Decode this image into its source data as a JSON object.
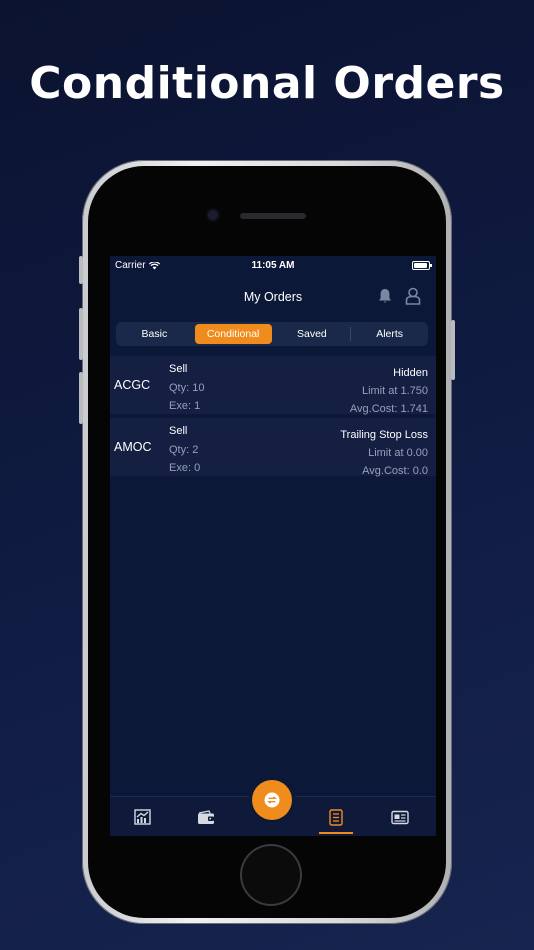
{
  "headline": "Conditional Orders",
  "status": {
    "carrier": "Carrier",
    "time": "11:05 AM",
    "battery_level": 0.9
  },
  "nav": {
    "title": "My Orders",
    "icons": [
      "bell-icon",
      "user-icon"
    ]
  },
  "segments": [
    {
      "label": "Basic",
      "active": false
    },
    {
      "label": "Conditional",
      "active": true
    },
    {
      "label": "Saved",
      "active": false
    },
    {
      "label": "Alerts",
      "active": false
    }
  ],
  "orders": [
    {
      "symbol": "ACGC",
      "side": "Sell",
      "qty": "Qty: 10",
      "exe": "Exe: 1",
      "type": "Hidden",
      "limit": "Limit at 1.750",
      "avg_cost": "Avg.Cost: 1.741"
    },
    {
      "symbol": "AMOC",
      "side": "Sell",
      "qty": "Qty: 2",
      "exe": "Exe: 0",
      "type": "Trailing Stop Loss",
      "limit": "Limit at 0.00",
      "avg_cost": "Avg.Cost: 0.0"
    }
  ],
  "tabbar": {
    "items": [
      "chart-icon",
      "wallet-icon",
      "orders-icon",
      "news-icon"
    ],
    "active": "orders-icon",
    "fab_icon": "swap-icon"
  },
  "colors": {
    "accent": "#f08c1c",
    "background": "#0c1838",
    "row": "#141f42"
  }
}
